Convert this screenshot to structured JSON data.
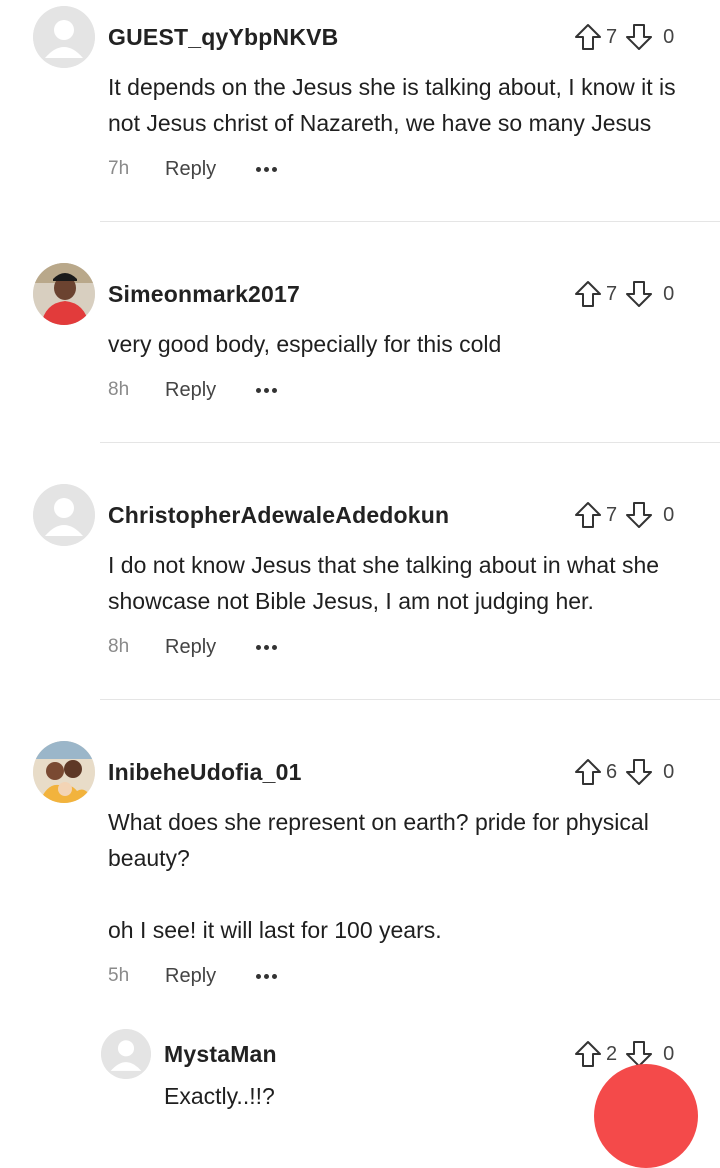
{
  "comments": [
    {
      "username": "GUEST_qyYbpNKVB",
      "upvotes": "7",
      "downvotes": "0",
      "text": "It depends on the Jesus she is talking about, I know it is not Jesus christ of Nazareth, we have so many Jesus",
      "time": "7h",
      "reply": "Reply"
    },
    {
      "username": "Simeonmark2017",
      "upvotes": "7",
      "downvotes": "0",
      "text": "very good body, especially for this cold",
      "time": "8h",
      "reply": "Reply"
    },
    {
      "username": "ChristopherAdewaleAdedokun",
      "upvotes": "7",
      "downvotes": "0",
      "text": "I do not know Jesus that she talking about in what she showcase not Bible Jesus, I am not judging her.",
      "time": "8h",
      "reply": "Reply"
    },
    {
      "username": "InibeheUdofia_01",
      "upvotes": "6",
      "downvotes": "0",
      "text_line1": "What does she represent on earth? pride for physical beauty?",
      "text_line2": "oh I see! it will last for 100 years.",
      "time": "5h",
      "reply": "Reply"
    },
    {
      "username": "MystaMan",
      "upvotes": "2",
      "downvotes": "0",
      "text_partial": "Exactly..!!?"
    }
  ],
  "colors": {
    "accent": "#f44a4a",
    "divider": "#e5e5e5",
    "muted": "#8a8a8a"
  }
}
